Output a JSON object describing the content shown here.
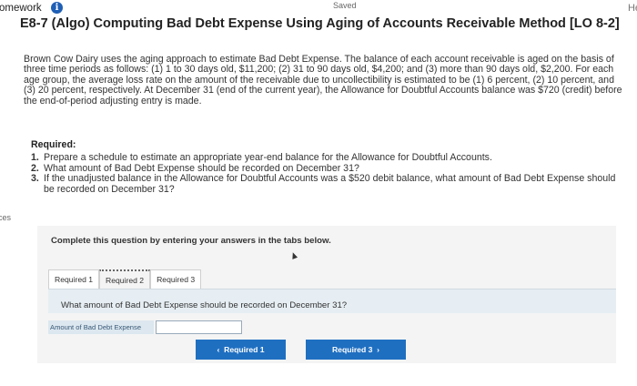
{
  "header": {
    "homework_label": "omework",
    "saved_label": "Saved",
    "right_corner_label": "He"
  },
  "side_tab_label": "ces",
  "problem": {
    "title": "E8-7 (Algo) Computing Bad Debt Expense Using Aging of Accounts Receivable Method [LO 8-2]",
    "text": "Brown Cow Dairy uses the aging approach to estimate Bad Debt Expense. The balance of each account receivable is aged on the basis of three time periods as follows: (1) 1 to 30 days old, $11,200; (2) 31 to 90 days old, $4,200; and (3) more than 90 days old, $2,200. For each age group, the average loss rate on the amount of the receivable due to uncollectibility is estimated to be (1) 6 percent, (2) 10 percent, and (3) 20 percent, respectively. At December 31 (end of the current year), the Allowance for Doubtful Accounts balance was $720 (credit) before the end-of-period adjusting entry is made.",
    "required_heading": "Required:",
    "requirements": [
      {
        "num": "1.",
        "text": "Prepare a schedule to estimate an appropriate year-end balance for the Allowance for Doubtful Accounts."
      },
      {
        "num": "2.",
        "text": "What amount of Bad Debt Expense should be recorded on December 31?"
      },
      {
        "num": "3.",
        "text": "If the unadjusted balance in the Allowance for Doubtful Accounts was a $520 debit balance, what amount of Bad Debt Expense should be recorded on December 31?"
      }
    ]
  },
  "panel": {
    "instruction": "Complete this question by entering your answers in the tabs below.",
    "tabs": [
      {
        "label": "Required 1",
        "active": false
      },
      {
        "label": "Required 2",
        "active": true
      },
      {
        "label": "Required 3",
        "active": false
      }
    ],
    "question": "What amount of Bad Debt Expense should be recorded on December 31?",
    "answer_label": "Amount of Bad Debt Expense",
    "answer_value": "",
    "prev_button": "Required 1",
    "next_button": "Required 3",
    "prev_icon": "chevron-left-icon",
    "next_icon": "chevron-right-icon"
  },
  "colors": {
    "accent": "#1f6fc1",
    "info_icon": "#1f5fb5",
    "tab_content_bg": "#e6eef3"
  }
}
